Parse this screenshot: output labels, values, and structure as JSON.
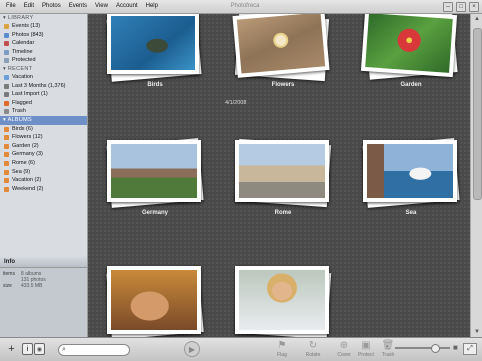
{
  "app": {
    "title": "Photofreca"
  },
  "menu": [
    "File",
    "Edit",
    "Photos",
    "Events",
    "View",
    "Account",
    "Help"
  ],
  "sidebar": {
    "library_header": "LIBRARY",
    "library": [
      {
        "label": "Events (13)",
        "color": "#d9a441"
      },
      {
        "label": "Photos (843)",
        "color": "#5a8ed0"
      },
      {
        "label": "Calendar",
        "color": "#c0504d"
      },
      {
        "label": "Timeline",
        "color": "#7d9bc4"
      },
      {
        "label": "Protected",
        "color": "#8aa0b8"
      }
    ],
    "recent_header": "RECENT",
    "recent": [
      {
        "label": "Vacation",
        "color": "#6aa0d8"
      },
      {
        "label": "Last 3 Months (1,376)",
        "color": "#7a7a7a"
      },
      {
        "label": "Last Import (1)",
        "color": "#7a7a7a"
      },
      {
        "label": "Flagged",
        "color": "#e06a2a"
      },
      {
        "label": "Trash",
        "color": "#8a8a8a"
      }
    ],
    "albums_header": "ALBUMS",
    "albums": [
      {
        "label": "Birds (6)",
        "color": "#e08a3a"
      },
      {
        "label": "Flowers (12)",
        "color": "#e08a3a"
      },
      {
        "label": "Garden (2)",
        "color": "#e08a3a"
      },
      {
        "label": "Germany (3)",
        "color": "#e08a3a"
      },
      {
        "label": "Rome (6)",
        "color": "#e08a3a"
      },
      {
        "label": "Sea (9)",
        "color": "#e08a3a"
      },
      {
        "label": "Vacation (2)",
        "color": "#e08a3a"
      },
      {
        "label": "Weekend (2)",
        "color": "#e08a3a"
      }
    ]
  },
  "info": {
    "title": "Info",
    "rows": [
      {
        "key": "items",
        "value": "8 albums"
      },
      {
        "key": "",
        "value": "131 photos"
      },
      {
        "key": "size",
        "value": "433.5 MB"
      }
    ]
  },
  "main": {
    "date_label": "4/1/2008",
    "albums": [
      {
        "name": "Birds"
      },
      {
        "name": "Flowers"
      },
      {
        "name": "Garden"
      },
      {
        "name": "Germany"
      },
      {
        "name": "Rome"
      },
      {
        "name": "Sea"
      },
      {
        "name": ""
      },
      {
        "name": ""
      }
    ]
  },
  "toolbar": {
    "search_placeholder": "",
    "tools": [
      "Flag",
      "Rotate",
      "Cover",
      "Protect",
      "Trash"
    ]
  },
  "colors": {
    "accent": "#6f8fc7",
    "viewer_bg": "#4a4a4a"
  }
}
